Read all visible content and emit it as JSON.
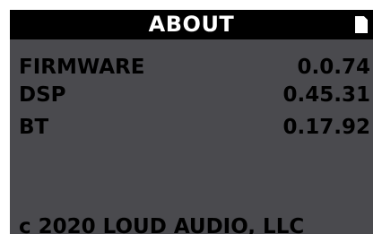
{
  "header": {
    "title": "ABOUT",
    "status_icon": "battery-icon"
  },
  "info": {
    "rows": [
      {
        "label": "FIRMWARE",
        "value": "0.0.74"
      },
      {
        "label": "DSP",
        "value": "0.45.31"
      },
      {
        "label": "BT",
        "value": "0.17.92"
      }
    ]
  },
  "footer": {
    "copyright": "c 2020 LOUD AUDIO, LLC"
  },
  "colors": {
    "background": "#4a4a4e",
    "title_bar": "#000000",
    "title_text": "#ffffff",
    "body_text": "#000000"
  }
}
